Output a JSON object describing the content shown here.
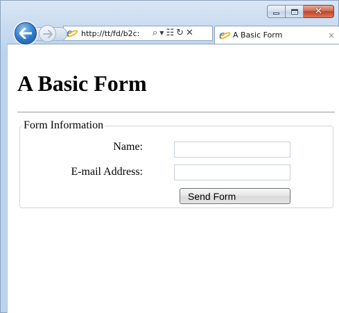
{
  "window": {
    "minimize_icon": "minimize-icon",
    "maximize_icon": "maximize-icon",
    "close_icon": "close-icon"
  },
  "navigation": {
    "back_icon": "back-arrow-icon",
    "forward_icon": "forward-arrow-icon",
    "address_url": "http://tt/fd/b2c:",
    "search_icon": "search-icon",
    "dropdown_icon": "chevron-down-icon",
    "compat_icon": "compatibility-view-icon",
    "refresh_icon": "refresh-icon",
    "stop_icon": "stop-icon"
  },
  "tab": {
    "title": "A Basic Form",
    "close_glyph": "×"
  },
  "page": {
    "heading": "A Basic Form",
    "fieldset_legend": "Form Information",
    "name_label": "Name:",
    "name_value": "",
    "email_label": "E-mail Address:",
    "email_value": "",
    "submit_label": "Send Form"
  },
  "colors": {
    "chrome_blue": "#c9dbf0",
    "back_button": "#2e78c6",
    "close_button": "#c2432a"
  }
}
